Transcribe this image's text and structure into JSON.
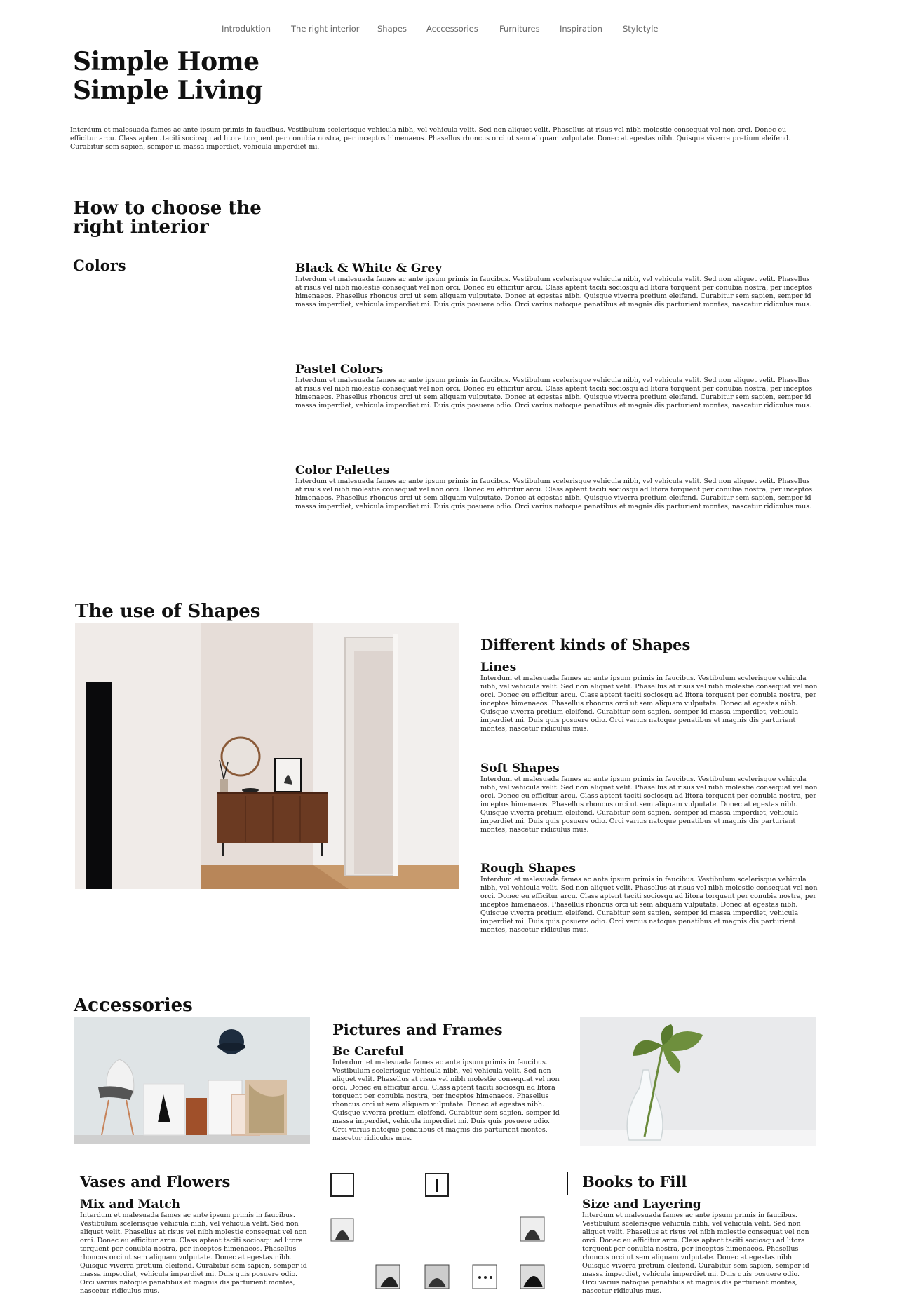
{
  "nav": {
    "items": [
      "Introduktion",
      "The right interior",
      "Shapes",
      "Acccessories",
      "Furnitures",
      "Inspiration",
      "Styletyle"
    ]
  },
  "hero": {
    "title_line1": "Simple Home",
    "title_line2": "Simple Living",
    "text": "Interdum et malesuada fames ac ante ipsum primis in faucibus. Vestibulum scelerisque vehicula nibh, vel vehicula velit. Sed non aliquet velit. Phasellus at risus vel nibh molestie consequat vel non orci. Donec eu efficitur arcu. Class aptent taciti sociosqu ad litora torquent per conubia nostra, per inceptos himenaeos. Phasellus rhoncus orci ut sem aliquam vulputate. Donec at egestas nibh. Quisque viverra pretium eleifend. Curabitur sem sapien, semper id massa imperdiet, vehicula imperdiet mi."
  },
  "interior": {
    "title_line1": "How to choose the",
    "title_line2": "right interior",
    "colors_heading": "Colors",
    "blocks": [
      {
        "title": "Black & White & Grey",
        "text": "Interdum et malesuada fames ac ante ipsum primis in faucibus. Vestibulum scelerisque vehicula nibh, vel vehicula velit. Sed non aliquet velit. Phasellus at risus vel nibh molestie consequat vel non orci. Donec eu efficitur arcu. Class aptent taciti sociosqu ad litora torquent per conubia nostra, per inceptos himenaeos. Phasellus rhoncus orci ut sem aliquam vulputate. Donec at egestas nibh. Quisque viverra pretium eleifend. Curabitur sem sapien, semper id massa imperdiet, vehicula imperdiet mi. Duis quis posuere odio. Orci varius natoque penatibus et magnis dis parturient montes, nascetur ridiculus mus."
      },
      {
        "title": "Pastel Colors",
        "text": "Interdum et malesuada fames ac ante ipsum primis in faucibus. Vestibulum scelerisque vehicula nibh, vel vehicula velit. Sed non aliquet velit. Phasellus at risus vel nibh molestie consequat vel non orci. Donec eu efficitur arcu. Class aptent taciti sociosqu ad litora torquent per conubia nostra, per inceptos himenaeos. Phasellus rhoncus orci ut sem aliquam vulputate. Donec at egestas nibh. Quisque viverra pretium eleifend. Curabitur sem sapien, semper id massa imperdiet, vehicula imperdiet mi. Duis quis posuere odio. Orci varius natoque penatibus et magnis dis parturient montes, nascetur ridiculus mus."
      },
      {
        "title": "Color Palettes",
        "text": "Interdum et malesuada fames ac ante ipsum primis in faucibus. Vestibulum scelerisque vehicula nibh, vel vehicula velit. Sed non aliquet velit. Phasellus at risus vel nibh molestie consequat vel non orci. Donec eu efficitur arcu. Class aptent taciti sociosqu ad litora torquent per conubia nostra, per inceptos himenaeos. Phasellus rhoncus orci ut sem aliquam vulputate. Donec at egestas nibh. Quisque viverra pretium eleifend. Curabitur sem sapien, semper id massa imperdiet, vehicula imperdiet mi. Duis quis posuere odio. Orci varius natoque penatibus et magnis dis parturient montes, nascetur ridiculus mus."
      }
    ]
  },
  "shapes": {
    "title": "The use of Shapes",
    "subtitle": "Different kinds of Shapes",
    "blocks": [
      {
        "title": "Lines",
        "text": "Interdum et malesuada fames ac ante ipsum primis in faucibus. Vestibulum scelerisque vehicula nibh, vel vehicula velit. Sed non aliquet velit. Phasellus at risus vel nibh molestie consequat vel non orci. Donec eu efficitur arcu. Class aptent taciti sociosqu ad litora torquent per conubia nostra, per inceptos himenaeos. Phasellus rhoncus orci ut sem aliquam vulputate. Donec at egestas nibh. Quisque viverra pretium eleifend. Curabitur sem sapien, semper id massa imperdiet, vehicula imperdiet mi. Duis quis posuere odio. Orci varius natoque penatibus et magnis dis parturient montes, nascetur ridiculus mus."
      },
      {
        "title": "Soft Shapes",
        "text": "Interdum et malesuada fames ac ante ipsum primis in faucibus. Vestibulum scelerisque vehicula nibh, vel vehicula velit. Sed non aliquet velit. Phasellus at risus vel nibh molestie consequat vel non orci. Donec eu efficitur arcu. Class aptent taciti sociosqu ad litora torquent per conubia nostra, per inceptos himenaeos. Phasellus rhoncus orci ut sem aliquam vulputate. Donec at egestas nibh. Quisque viverra pretium eleifend. Curabitur sem sapien, semper id massa imperdiet, vehicula imperdiet mi. Duis quis posuere odio. Orci varius natoque penatibus et magnis dis parturient montes, nascetur ridiculus mus."
      },
      {
        "title": "Rough Shapes",
        "text": "Interdum et malesuada fames ac ante ipsum primis in faucibus. Vestibulum scelerisque vehicula nibh, vel vehicula velit. Sed non aliquet velit. Phasellus at risus vel nibh molestie consequat vel non orci. Donec eu efficitur arcu. Class aptent taciti sociosqu ad litora torquent per conubia nostra, per inceptos himenaeos. Phasellus rhoncus orci ut sem aliquam vulputate. Donec at egestas nibh. Quisque viverra pretium eleifend. Curabitur sem sapien, semper id massa imperdiet, vehicula imperdiet mi. Duis quis posuere odio. Orci varius natoque penatibus et magnis dis parturient montes, nascetur ridiculus mus."
      }
    ]
  },
  "accessories": {
    "title": "Accessories",
    "pictures": {
      "title": "Pictures and Frames",
      "subtitle": "Be Careful",
      "text": "Interdum et malesuada fames ac ante ipsum primis in faucibus. Vestibulum scelerisque vehicula nibh, vel vehicula velit. Sed non aliquet velit. Phasellus at risus vel nibh molestie consequat vel non orci. Donec eu efficitur arcu. Class aptent taciti sociosqu ad litora torquent per conubia nostra, per inceptos himenaeos. Phasellus rhoncus orci ut sem aliquam vulputate. Donec at egestas nibh. Quisque viverra pretium eleifend. Curabitur sem sapien, semper id massa imperdiet, vehicula imperdiet mi. Duis quis posuere odio. Orci varius natoque penatibus et magnis dis parturient montes, nascetur ridiculus mus."
    },
    "vases": {
      "title": "Vases and Flowers",
      "subtitle": "Mix and Match",
      "text": "Interdum et malesuada fames ac ante ipsum primis in faucibus. Vestibulum scelerisque vehicula nibh, vel vehicula velit. Sed non aliquet velit. Phasellus at risus vel nibh molestie consequat vel non orci. Donec eu efficitur arcu. Class aptent taciti sociosqu ad litora torquent per conubia nostra, per inceptos himenaeos. Phasellus rhoncus orci ut sem aliquam vulputate. Donec at egestas nibh. Quisque viverra pretium eleifend. Curabitur sem sapien, semper id massa imperdiet, vehicula imperdiet mi. Duis quis posuere odio. Orci varius natoque penatibus et magnis dis parturient montes, nascetur ridiculus mus."
    },
    "books": {
      "title": "Books to Fill",
      "subtitle": "Size and Layering",
      "text": "Interdum et malesuada fames ac ante ipsum primis in faucibus. Vestibulum scelerisque vehicula nibh, vel vehicula velit. Sed non aliquet velit. Phasellus at risus vel nibh molestie consequat vel non orci. Donec eu efficitur arcu. Class aptent taciti sociosqu ad litora torquent per conubia nostra, per inceptos himenaeos. Phasellus rhoncus orci ut sem aliquam vulputate. Donec at egestas nibh. Quisque viverra pretium eleifend. Curabitur sem sapien, semper id massa imperdiet, vehicula imperdiet mi. Duis quis posuere odio. Orci varius natoque penatibus et magnis dis parturient montes, nascetur ridiculus mus."
    }
  }
}
